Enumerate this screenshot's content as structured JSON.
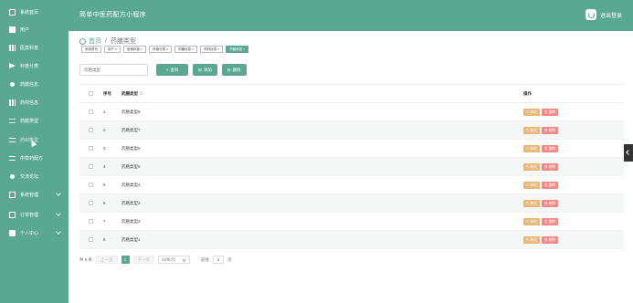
{
  "header": {
    "title": "简单中医药配方小程序",
    "logout": "退出登录"
  },
  "sidebar": {
    "items": [
      {
        "label": "系统首页",
        "icon": "home-icon"
      },
      {
        "label": "用户",
        "icon": "user-icon"
      },
      {
        "label": "医案科普",
        "icon": "list-icon"
      },
      {
        "label": "科普分类",
        "icon": "plane-icon"
      },
      {
        "label": "药膳信息",
        "icon": "user-icon"
      },
      {
        "label": "药材信息",
        "icon": "grid-icon"
      },
      {
        "label": "药膳类型",
        "icon": "list-icon"
      },
      {
        "label": "药材类型",
        "icon": "box-icon"
      },
      {
        "label": "中草药配方",
        "icon": "list-icon"
      },
      {
        "label": "交流论坛",
        "icon": "user-icon"
      },
      {
        "label": "系统管理",
        "icon": "doc-icon"
      },
      {
        "label": "订单管理",
        "icon": "doc-icon"
      },
      {
        "label": "个人中心",
        "icon": "lock-icon"
      }
    ]
  },
  "breadcrumb": {
    "home": "首页",
    "separator": "/",
    "current": "药膳类型"
  },
  "tags": [
    {
      "label": "系统首页",
      "closable": false
    },
    {
      "label": "用户",
      "closable": true
    },
    {
      "label": "医案科普",
      "closable": true
    },
    {
      "label": "科普分类",
      "closable": true
    },
    {
      "label": "药膳信息",
      "closable": true
    },
    {
      "label": "药材信息",
      "closable": true
    },
    {
      "label": "药膳类型",
      "closable": true,
      "active": true
    }
  ],
  "search": {
    "placeholder": "药膳类型",
    "search_label": "查询",
    "add_label": "添加",
    "delete_label": "删除"
  },
  "table": {
    "headers": {
      "index": "序号",
      "name": "药膳类型",
      "ops": "操作"
    },
    "rows": [
      {
        "idx": "1",
        "name": "药膳类型8"
      },
      {
        "idx": "2",
        "name": "药膳类型7"
      },
      {
        "idx": "3",
        "name": "药膳类型6"
      },
      {
        "idx": "4",
        "name": "药膳类型5"
      },
      {
        "idx": "5",
        "name": "药膳类型4"
      },
      {
        "idx": "6",
        "name": "药膳类型3"
      },
      {
        "idx": "7",
        "name": "药膳类型2"
      },
      {
        "idx": "8",
        "name": "药膳类型1"
      }
    ],
    "edit_label": "修改",
    "delete_label": "删除"
  },
  "pager": {
    "total": "共 8 条",
    "prev": "上一页",
    "current": "1",
    "next": "下一页",
    "page_size": "10条/页",
    "goto_label": "前往",
    "goto_value": "1",
    "page_unit": "页"
  },
  "colors": {
    "primary": "#5aa892",
    "edit": "#e9b67b",
    "delete": "#f08a86"
  }
}
